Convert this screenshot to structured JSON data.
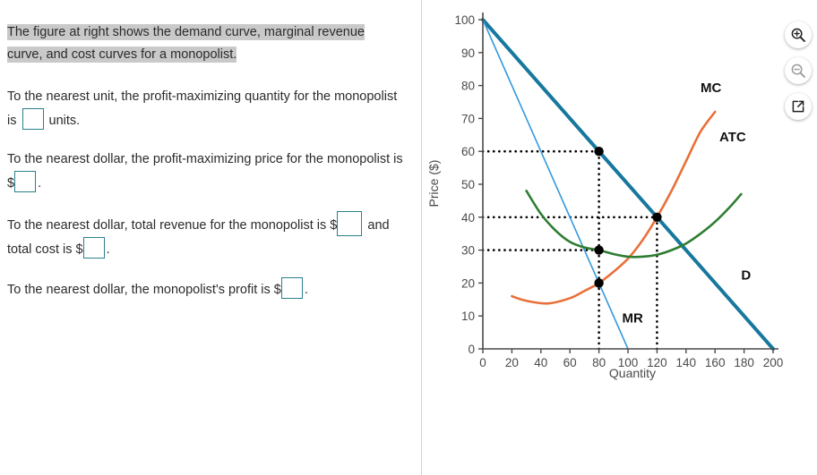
{
  "question": {
    "intro_highlighted": "The figure at right shows the demand curve, marginal revenue curve, and cost curves for a monopolist.",
    "q1_part1": "To the nearest unit, the profit-maximizing quantity for the monopolist is",
    "q1_part2": "units.",
    "q2_part1": "To the nearest dollar, the profit-maximizing price for the monopolist is $",
    "q2_part2": ".",
    "q3_part1": "To the nearest dollar, total revenue for the monopolist is $",
    "q3_part2": "and total cost is $",
    "q3_part3": ".",
    "q4_part1": "To the nearest dollar, the monopolist's profit is $",
    "q4_part2": ".",
    "inputs": {
      "quantity_value": "",
      "price_value": "",
      "total_revenue_value": "",
      "total_cost_value": "",
      "profit_value": ""
    }
  },
  "toolbar": {
    "items": [
      {
        "icon": "zoom-in-icon",
        "label": "Zoom in",
        "enabled": true
      },
      {
        "icon": "zoom-out-icon",
        "label": "Zoom out",
        "enabled": false
      },
      {
        "icon": "open-in-new-icon",
        "label": "Open in new window",
        "enabled": true
      }
    ]
  },
  "colors": {
    "demand": "#17789E",
    "marginal_revenue": "#3399DD",
    "marginal_cost": "#E8703A",
    "average_total_cost": "#2E7D32",
    "point": "#000000",
    "guide": "#000000",
    "axis": "#4a4a4a",
    "input_border": "#2b7f8c",
    "highlight": "#c9c9c9"
  },
  "chart_data": {
    "type": "line",
    "title": "",
    "xlabel": "Quantity",
    "ylabel": "Price ($)",
    "xlim": [
      0,
      200
    ],
    "ylim": [
      0,
      100
    ],
    "xticks": [
      0,
      20,
      40,
      60,
      80,
      100,
      120,
      140,
      160,
      180,
      200
    ],
    "yticks": [
      0,
      10,
      20,
      30,
      40,
      50,
      60,
      70,
      80,
      90,
      100
    ],
    "grid": false,
    "legend": "inline-curve-labels",
    "series": [
      {
        "name": "D",
        "label": "D",
        "type": "line",
        "color": "#17789E",
        "width": 4,
        "label_x": 178,
        "label_y": 21,
        "points": [
          [
            0,
            100
          ],
          [
            200,
            0
          ]
        ]
      },
      {
        "name": "MR",
        "label": "MR",
        "type": "line",
        "color": "#3399DD",
        "width": 1.6,
        "label_x": 96,
        "label_y": 8,
        "points": [
          [
            0,
            100
          ],
          [
            100,
            0
          ]
        ]
      },
      {
        "name": "MC",
        "label": "MC",
        "type": "curve",
        "color": "#E8703A",
        "width": 2.6,
        "label_x": 150,
        "label_y": 78,
        "points": [
          [
            20,
            16
          ],
          [
            30,
            14.6
          ],
          [
            45,
            13.8
          ],
          [
            60,
            15.4
          ],
          [
            70,
            17.6
          ],
          [
            80,
            20
          ],
          [
            90,
            23.4
          ],
          [
            100,
            27.4
          ],
          [
            110,
            33
          ],
          [
            120,
            40
          ],
          [
            130,
            48
          ],
          [
            140,
            57
          ],
          [
            150,
            66
          ],
          [
            160,
            72
          ]
        ]
      },
      {
        "name": "ATC",
        "label": "ATC",
        "type": "curve",
        "color": "#2E7D32",
        "width": 2.6,
        "label_x": 163,
        "label_y": 63,
        "points": [
          [
            30,
            48
          ],
          [
            40,
            41
          ],
          [
            50,
            36
          ],
          [
            60,
            32.5
          ],
          [
            70,
            30.8
          ],
          [
            80,
            30
          ],
          [
            90,
            28.8
          ],
          [
            100,
            28
          ],
          [
            110,
            28
          ],
          [
            120,
            28.6
          ],
          [
            130,
            30
          ],
          [
            140,
            32
          ],
          [
            150,
            35
          ],
          [
            160,
            38.6
          ],
          [
            170,
            43
          ],
          [
            178,
            47
          ]
        ]
      }
    ],
    "points_marked": [
      {
        "name": "price-point",
        "x": 80,
        "y": 60,
        "note": "price on demand at Q=80"
      },
      {
        "name": "atc-point",
        "x": 80,
        "y": 30,
        "note": "ATC at Q=80"
      },
      {
        "name": "mr-mc-point",
        "x": 80,
        "y": 20,
        "note": "MR = MC"
      },
      {
        "name": "mc-demand-point",
        "x": 120,
        "y": 40,
        "note": "MC crosses D"
      }
    ],
    "guide_lines": [
      {
        "name": "h-guide-60",
        "from": [
          0,
          60
        ],
        "to": [
          80,
          60
        ]
      },
      {
        "name": "h-guide-40",
        "from": [
          0,
          40
        ],
        "to": [
          120,
          40
        ]
      },
      {
        "name": "h-guide-30",
        "from": [
          0,
          30
        ],
        "to": [
          80,
          30
        ]
      },
      {
        "name": "v-guide-80",
        "from": [
          80,
          0
        ],
        "to": [
          80,
          60
        ]
      },
      {
        "name": "v-guide-120",
        "from": [
          120,
          0
        ],
        "to": [
          120,
          40
        ]
      }
    ]
  }
}
